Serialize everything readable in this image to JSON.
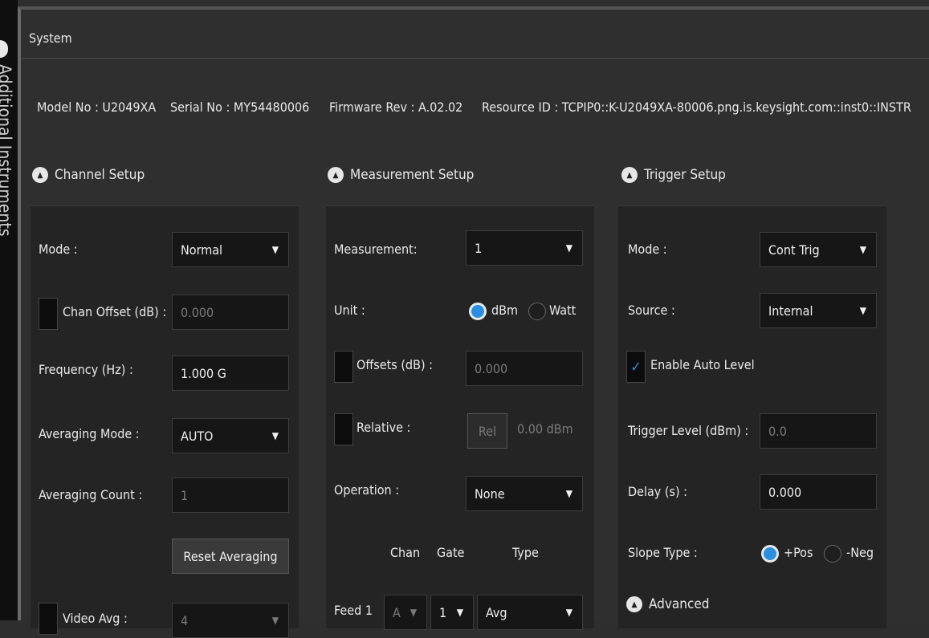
{
  "sidebar": {
    "label": "Additional Instruments"
  },
  "window": {
    "title": "System"
  },
  "info": {
    "model": "Model No :  U2049XA",
    "serial": "Serial No :  MY54480006",
    "firmware": "Firmware Rev :  A.02.02",
    "resource": "Resource ID :  TCPIP0::K-U2049XA-80006.png.is.keysight.com::inst0::INSTR"
  },
  "channel": {
    "title": "Channel Setup",
    "mode_label": "Mode :",
    "mode_value": "Normal",
    "offset_label": "Chan Offset (dB) :",
    "offset_value": "0.000",
    "freq_label": "Frequency (Hz) :",
    "freq_value": "1.000 G",
    "avgmode_label": "Averaging Mode :",
    "avgmode_value": "AUTO",
    "avgcount_label": "Averaging Count :",
    "avgcount_value": "1",
    "reset_label": "Reset Averaging",
    "video_label": "Video Avg :",
    "video_value": "4"
  },
  "measurement": {
    "title": "Measurement Setup",
    "meas_label": "Measurement:",
    "meas_value": "1",
    "unit_label": "Unit :",
    "unit_dbm": "dBm",
    "unit_watt": "Watt",
    "offsets_label": "Offsets (dB) :",
    "offsets_value": "0.000",
    "relative_label": "Relative :",
    "rel_button": "Rel",
    "rel_value": "0.00 dBm",
    "op_label": "Operation :",
    "op_value": "None",
    "col_chan": "Chan",
    "col_gate": "Gate",
    "col_type": "Type",
    "feed_label": "Feed 1",
    "feed_chan": "A",
    "feed_gate": "1",
    "feed_type": "Avg"
  },
  "trigger": {
    "title": "Trigger Setup",
    "mode_label": "Mode :",
    "mode_value": "Cont Trig",
    "source_label": "Source :",
    "source_value": "Internal",
    "autolevel_label": "Enable Auto Level",
    "level_label": "Trigger Level (dBm) :",
    "level_value": "0.0",
    "delay_label": "Delay (s) :",
    "delay_value": "0.000",
    "slope_label": "Slope Type :",
    "slope_pos": "+Pos",
    "slope_neg": "-Neg",
    "advanced_label": "Advanced"
  },
  "colors": {
    "accent": "#2a8fe0",
    "panel": "#242424",
    "field": "#161616"
  }
}
